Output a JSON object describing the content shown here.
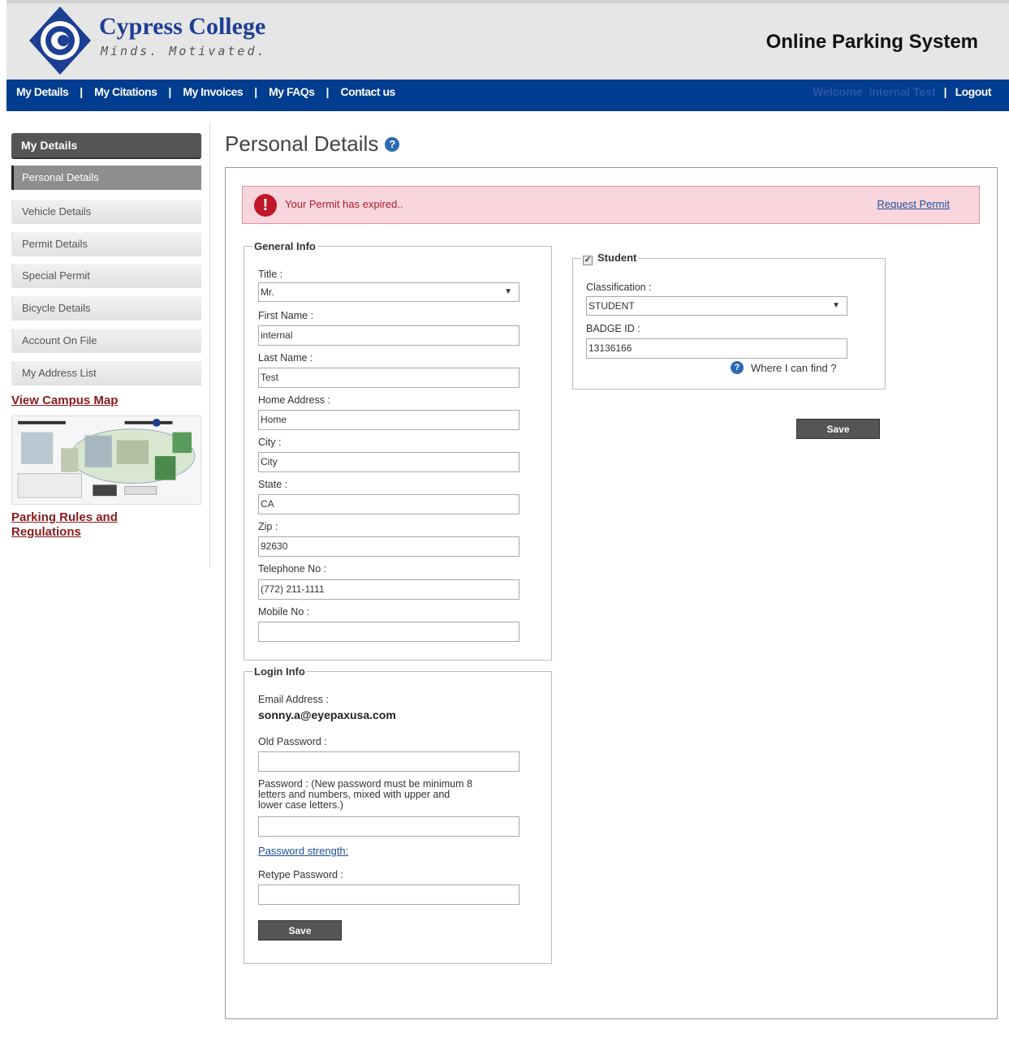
{
  "header": {
    "brand_name": "Cypress College",
    "brand_tagline": "Minds. Motivated.",
    "system_title": "Online Parking System"
  },
  "nav": {
    "items": [
      "My Details",
      "My Citations",
      "My Invoices",
      "My FAQs",
      "Contact us"
    ],
    "welcome": "Welcome",
    "user_name": "internal Test",
    "logout": "Logout"
  },
  "sidebar": {
    "header": "My Details",
    "items": [
      "Personal Details",
      "Vehicle Details",
      "Permit Details",
      "Special Permit",
      "Bicycle Details",
      "Account On File",
      "My Address List"
    ],
    "active_index": 0,
    "view_map_link": "View Campus Map",
    "rules_link_line1": "Parking Rules and",
    "rules_link_line2": "Regulations"
  },
  "page": {
    "title": "Personal Details"
  },
  "alert": {
    "message": "Your Permit has expired..",
    "link": "Request Permit"
  },
  "general_info": {
    "legend": "General Info",
    "title_label": "Title :",
    "title_value": "Mr.",
    "first_name_label": "First Name :",
    "first_name_value": "internal",
    "last_name_label": "Last Name :",
    "last_name_value": "Test",
    "home_address_label": "Home Address :",
    "home_address_value": "Home",
    "city_label": "City :",
    "city_value": "City",
    "state_label": "State :",
    "state_value": "CA",
    "zip_label": "Zip :",
    "zip_value": "92630",
    "telephone_label": "Telephone No :",
    "telephone_value": "(772) 211-1111",
    "mobile_label": "Mobile No :",
    "mobile_value": ""
  },
  "student": {
    "legend": "Student",
    "checked": true,
    "classification_label": "Classification :",
    "classification_value": "STUDENT",
    "badge_label": "BADGE ID :",
    "badge_value": "13136166",
    "where_link": "Where I can find ?",
    "save": "Save"
  },
  "login_info": {
    "legend": "Login Info",
    "email_label": "Email Address :",
    "email_value": "sonny.a@eyepaxusa.com",
    "old_password_label": "Old Password :",
    "password_label_1": "Password : (New password must be minimum 8",
    "password_label_2": "letters and numbers, mixed with upper and",
    "password_label_3": "lower case letters.)",
    "strength_link": "Password strength:",
    "retype_label": "Retype Password :",
    "save": "Save"
  },
  "colors": {
    "nav_bg": "#003c8f",
    "alert_bg": "#f9d6de",
    "brand_blue": "#1c3f94",
    "link_red": "#8b1a1a"
  }
}
